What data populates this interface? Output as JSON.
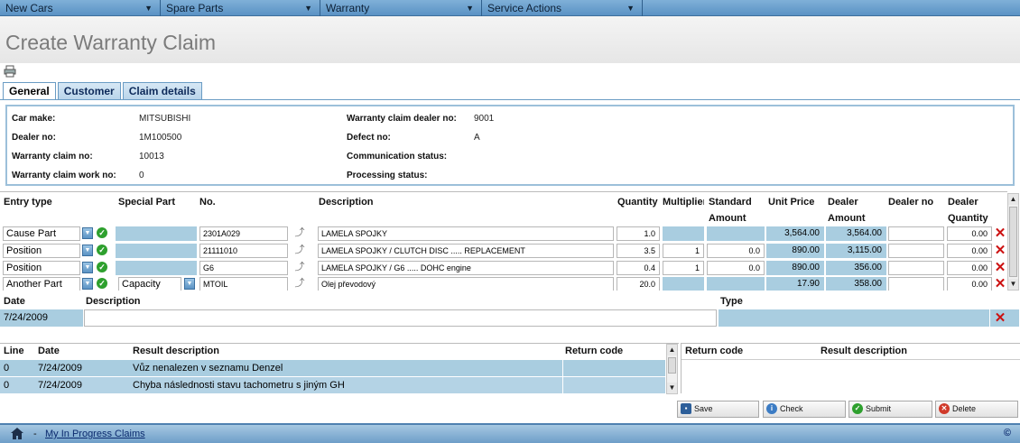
{
  "nav": [
    {
      "label": "New Cars"
    },
    {
      "label": "Spare Parts"
    },
    {
      "label": "Warranty"
    },
    {
      "label": "Service Actions"
    }
  ],
  "page": {
    "title": "Create Warranty Claim"
  },
  "tabs": [
    {
      "label": "General",
      "active": true
    },
    {
      "label": "Customer"
    },
    {
      "label": "Claim details"
    }
  ],
  "header": {
    "car_make_label": "Car make:",
    "car_make": "MITSUBISHI",
    "dealer_no_label": "Dealer no:",
    "dealer_no": "1M100500",
    "claim_no_label": "Warranty claim no:",
    "claim_no": "10013",
    "work_no_label": "Warranty claim work no:",
    "work_no": "0",
    "claim_dealer_no_label": "Warranty claim dealer no:",
    "claim_dealer_no": "9001",
    "defect_no_label": "Defect no:",
    "defect_no": "A",
    "comm_status_label": "Communication status:",
    "comm_status": "",
    "proc_status_label": "Processing status:",
    "proc_status": ""
  },
  "entries": {
    "columns": {
      "entry_type": "Entry type",
      "special_part": "Special Part",
      "no": "No.",
      "description": "Description",
      "quantity": "Quantity",
      "multiplier": "Multiplier",
      "standard": "Standard",
      "standard2": "Amount",
      "unit_price": "Unit Price",
      "dealer_amount": "Dealer",
      "dealer_amount2": "Amount",
      "dealer_no": "Dealer no",
      "dealer_qty": "Dealer",
      "dealer_qty2": "Quantity"
    },
    "rows": [
      {
        "entry_type": "Cause Part",
        "special": "",
        "no": "2301A029",
        "description": "LAMELA SPOJKY",
        "quantity": "1.0",
        "multiplier": "",
        "standard": "",
        "unit_price": "3,564.00",
        "dealer_amount": "3,564.00",
        "dealer_no": "",
        "dealer_qty": "0.00"
      },
      {
        "entry_type": "Position",
        "special": "",
        "no": "21111010",
        "description": "LAMELA SPOJKY / CLUTCH DISC ..... REPLACEMENT",
        "quantity": "3.5",
        "multiplier": "1",
        "standard": "0.0",
        "unit_price": "890.00",
        "dealer_amount": "3,115.00",
        "dealer_no": "",
        "dealer_qty": "0.00"
      },
      {
        "entry_type": "Position",
        "special": "",
        "no": "G6",
        "description": "LAMELA SPOJKY / G6 ..... DOHC engine",
        "quantity": "0.4",
        "multiplier": "1",
        "standard": "0.0",
        "unit_price": "890.00",
        "dealer_amount": "356.00",
        "dealer_no": "",
        "dealer_qty": "0.00"
      },
      {
        "entry_type": "Another Part",
        "special": "Capacity",
        "no": "MTOIL",
        "description": "Olej převodový",
        "quantity": "20.0",
        "multiplier": "",
        "standard": "",
        "unit_price": "17.90",
        "dealer_amount": "358.00",
        "dealer_no": "",
        "dealer_qty": "0.00"
      }
    ]
  },
  "notes": {
    "columns": {
      "date": "Date",
      "description": "Description",
      "type": "Type"
    },
    "row": {
      "date": "7/24/2009",
      "description": "",
      "type": ""
    }
  },
  "results": {
    "columns": {
      "line": "Line",
      "date": "Date",
      "result": "Result description",
      "return_code": "Return code"
    },
    "rows": [
      {
        "line": "0",
        "date": "7/24/2009",
        "result": "Vůz nenalezen v seznamu Denzel",
        "return_code": ""
      },
      {
        "line": "0",
        "date": "7/24/2009",
        "result": "Chyba následnosti stavu tachometru s jiným GH",
        "return_code": ""
      }
    ]
  },
  "codes": {
    "columns": {
      "return_code": "Return code",
      "result": "Result description"
    }
  },
  "buttons": {
    "save": "Save",
    "check": "Check",
    "submit": "Submit",
    "delete": "Delete"
  },
  "footer": {
    "separator": "-",
    "link": "My In Progress Claims",
    "copyright": "©"
  },
  "colors": {
    "nav": "#5a92c4",
    "grid_highlight": "#a9cde0",
    "delete_red": "#cc1111"
  }
}
